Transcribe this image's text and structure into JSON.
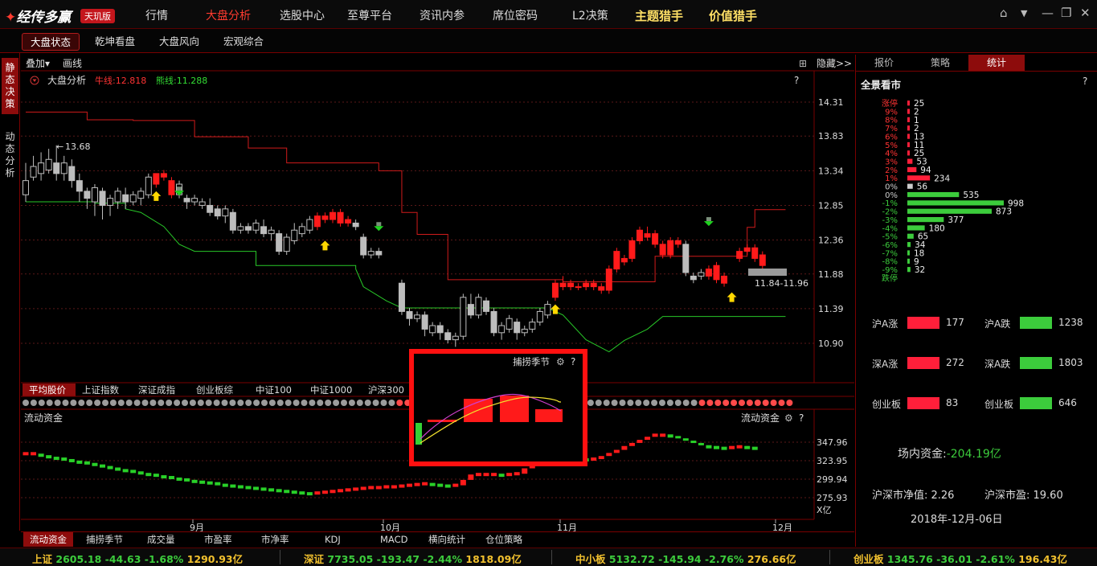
{
  "app": {
    "logo_text": "经传多赢",
    "edition_badge": "天玑版"
  },
  "menu": [
    "行情",
    "大盘分析",
    "选股中心",
    "至尊平台",
    "资讯内参",
    "席位密码",
    "L2决策"
  ],
  "menu_active": "大盘分析",
  "menu_featured": [
    "主题猎手",
    "价值猎手"
  ],
  "window_buttons": [
    "home-icon",
    "dropdown-icon",
    "minimize-icon",
    "restore-icon",
    "close-icon"
  ],
  "sub_tabs": [
    "大盘状态",
    "乾坤看盘",
    "大盘风向",
    "宏观综合"
  ],
  "sub_tab_active": "大盘状态",
  "left_tabs": [
    "静态决策",
    "动态分析"
  ],
  "left_tab_active": "静态决策",
  "chart_toolbar": {
    "overlay": "叠加▾",
    "draw": "画线",
    "hide": "隐藏>>",
    "help": "?"
  },
  "main_chart": {
    "title": "大盘分析",
    "bull_label": "牛线:12.818",
    "bear_label": "熊线:11.288",
    "y_ticks": [
      "14.31",
      "13.83",
      "13.34",
      "12.85",
      "12.36",
      "11.88",
      "11.39",
      "10.90"
    ],
    "annot_high": "13.68",
    "annot_range": "11.84-11.96"
  },
  "index_tabs": [
    "平均股价",
    "上证指数",
    "深证成指",
    "创业板综",
    "中证100",
    "中证1000",
    "沪深300"
  ],
  "index_tab_active": "平均股价",
  "flow_chart": {
    "title": "流动资金",
    "title_right": "流动资金",
    "y_ticks": [
      "347.96",
      "323.95",
      "299.94",
      "275.93"
    ],
    "unit": "X亿",
    "x_ticks": [
      "9月",
      "10月",
      "11月",
      "12月"
    ]
  },
  "popup": {
    "title": "捕捞季节"
  },
  "bottom_tabs": [
    "流动资金",
    "捕捞季节",
    "成交量",
    "市盈率",
    "市净率",
    "KDJ",
    "MACD",
    "横向统计",
    "仓位策略"
  ],
  "bottom_tab_active": "流动资金",
  "right_tabs": [
    "报价",
    "策略",
    "统计"
  ],
  "right_tab_active": "统计",
  "stats": {
    "title": "全景看市",
    "dist_labels": [
      "涨停",
      "9%",
      "8%",
      "7%",
      "6%",
      "5%",
      "4%",
      "3%",
      "2%",
      "1%",
      "0%",
      "0%",
      "-1%",
      "-2%",
      "-3%",
      "-4%",
      "-5%",
      "-6%",
      "-7%",
      "-8%",
      "-9%",
      "跌停"
    ],
    "dist_values": [
      25,
      2,
      1,
      2,
      13,
      11,
      25,
      53,
      94,
      234,
      56,
      535,
      998,
      873,
      377,
      180,
      65,
      34,
      18,
      9,
      32
    ],
    "rows": [
      {
        "l1": "沪A涨",
        "v1": "177",
        "l2": "沪A跌",
        "v2": "1238"
      },
      {
        "l1": "深A涨",
        "v1": "272",
        "l2": "深A跌",
        "v2": "1803"
      },
      {
        "l1": "创业板",
        "v1": "83",
        "l2": "创业板",
        "v2": "646"
      }
    ],
    "fund_label": "场内资金:",
    "fund_value": "-204.19亿",
    "pb_text": "沪深市净值: 2.26",
    "pe_text": "沪深市盈: 19.60",
    "date": "2018年-12月-06日"
  },
  "status_bar": [
    {
      "name": "上证",
      "price": "2605.18",
      "chg": "-44.63",
      "pct": "-1.68%",
      "amt": "1290.93亿"
    },
    {
      "name": "深证",
      "price": "7735.05",
      "chg": "-193.47",
      "pct": "-2.44%",
      "amt": "1818.09亿"
    },
    {
      "name": "中小板",
      "price": "5132.72",
      "chg": "-145.94",
      "pct": "-2.76%",
      "amt": "276.66亿"
    },
    {
      "name": "创业板",
      "price": "1345.76",
      "chg": "-36.01",
      "pct": "-2.61%",
      "amt": "196.43亿"
    }
  ],
  "colors": {
    "up": "#ff1a1a",
    "down": "#35d035",
    "accent": "#8d0c0c",
    "bull_line": "#d01b1b",
    "bear_line": "#28c828",
    "status_value": "#ffd75a"
  }
}
